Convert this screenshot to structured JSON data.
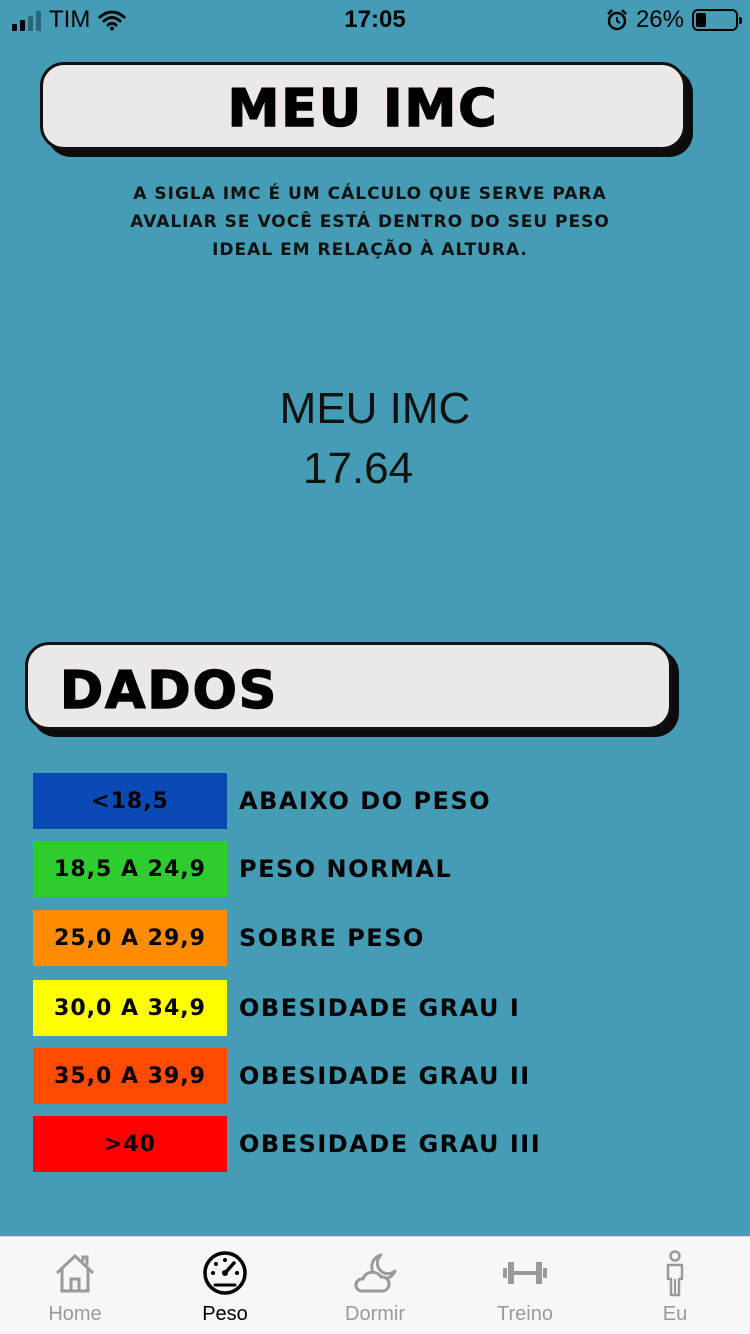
{
  "status_bar": {
    "carrier": "TIM",
    "time": "17:05",
    "battery_percent": "26%",
    "battery_level": 0.26,
    "icons": [
      "signal-icon",
      "wifi-icon",
      "alarm-icon",
      "battery-icon"
    ]
  },
  "header": {
    "title": "MEU IMC",
    "description": "A SIGLA IMC  É UM CÁLCULO QUE SERVE PARA AVALIAR SE VOCÊ  ESTÁ DENTRO DO SEU PESO IDEAL EM RELAÇÃO À ALTURA."
  },
  "result": {
    "label": "MEU IMC",
    "value": "17.64"
  },
  "dados": {
    "title": "DADOS",
    "rows": [
      {
        "range": "<18,5",
        "category": "ABAIXO DO PESO",
        "color": "#0b4ab5"
      },
      {
        "range": "18,5 A  24,9",
        "category": "PESO NORMAL",
        "color": "#2ecc2e"
      },
      {
        "range": "25,0 A  29,9",
        "category": "SOBRE PESO",
        "color": "#ff8c00"
      },
      {
        "range": "30,0 A  34,9",
        "category": "OBESIDADE GRAU I",
        "color": "#ffff00"
      },
      {
        "range": "35,0 A  39,9",
        "category": "OBESIDADE GRAU II",
        "color": "#ff4a00"
      },
      {
        "range": ">40",
        "category": "OBESIDADE GRAU III",
        "color": "#ff0000"
      }
    ]
  },
  "tabs": [
    {
      "label": "Home",
      "icon": "home-icon",
      "active": false
    },
    {
      "label": "Peso",
      "icon": "gauge-icon",
      "active": true
    },
    {
      "label": "Dormir",
      "icon": "moon-cloud-icon",
      "active": false
    },
    {
      "label": "Treino",
      "icon": "dumbbell-icon",
      "active": false
    },
    {
      "label": "Eu",
      "icon": "person-icon",
      "active": false
    }
  ]
}
